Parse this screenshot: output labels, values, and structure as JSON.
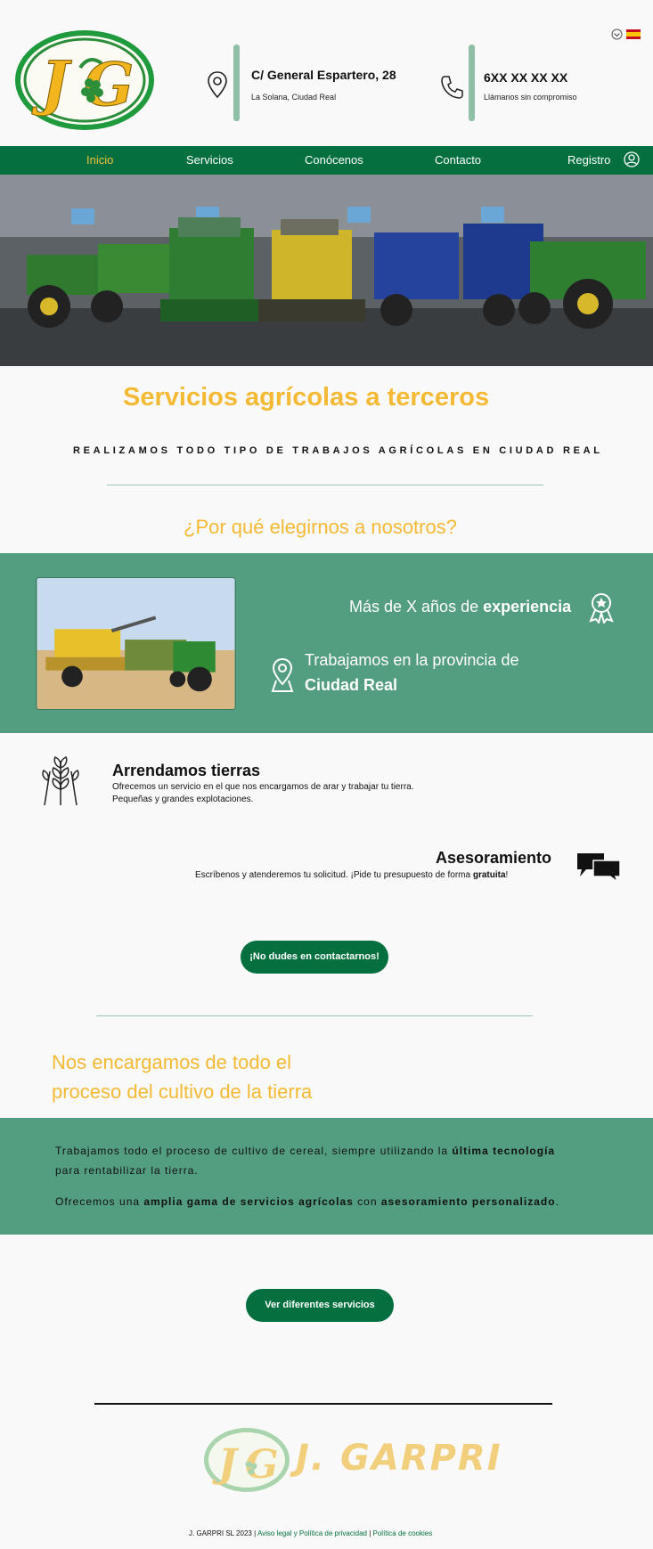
{
  "header": {
    "address_title": "C/ General Espartero, 28",
    "address_sub": "La Solana, Ciudad Real",
    "phone_title": "6XX XX XX XX",
    "phone_sub": "Llámanos sin compromiso"
  },
  "nav": {
    "items": [
      "Inicio",
      "Servicios",
      "Conócenos",
      "Contacto",
      "Registro"
    ]
  },
  "intro": {
    "title": "Servicios agrícolas a terceros",
    "subtitle": "REALIZAMOS TODO TIPO DE TRABAJOS AGRÍCOLAS EN CIUDAD REAL",
    "why": "¿Por qué elegirnos a nosotros?"
  },
  "features": {
    "experience_pre": "Más de X años de ",
    "experience_bold": "experiencia",
    "province_pre": "Trabajamos en la provincia de",
    "province_bold": "Ciudad Real"
  },
  "services": {
    "rent_title": "Arrendamos tierras",
    "rent_line1": "Ofrecemos un servicio en el que nos encargamos de arar y trabajar tu tierra.",
    "rent_line2": "Pequeñas y grandes explotaciones.",
    "advice_title": "Asesoramiento",
    "advice_pre": "Escríbenos y atenderemos tu solicitud. ¡Pide tu presupuesto de forma ",
    "advice_bold": "gratuita",
    "advice_post": "!",
    "contact_btn": "¡No dudes en contactarnos!"
  },
  "process": {
    "title_line1": "Nos encargamos de todo el",
    "title_line2": "proceso del cultivo de la tierra",
    "p1_pre": "Trabajamos todo el proceso de cultivo de cereal, siempre utilizando la ",
    "p1_bold": "última tecnología",
    "p1_post": "para rentabilizar la tierra.",
    "p2_pre": "Ofrecemos una ",
    "p2_bold1": "amplia gama de servicios agrícolas",
    "p2_mid": " con ",
    "p2_bold2": "asesoramiento personalizado",
    "p2_post": ".",
    "services_btn": "Ver diferentes servicios"
  },
  "footer": {
    "brand": "J. GARPRI",
    "copyright": "J. GARPRI SL 2023 | ",
    "legal": "Aviso legal y Política de privacidad",
    "sep": " | ",
    "cookies": "Política de cookies"
  },
  "colors": {
    "nav_green": "#04703f",
    "teal": "#539d81",
    "gold": "#f4b935"
  }
}
